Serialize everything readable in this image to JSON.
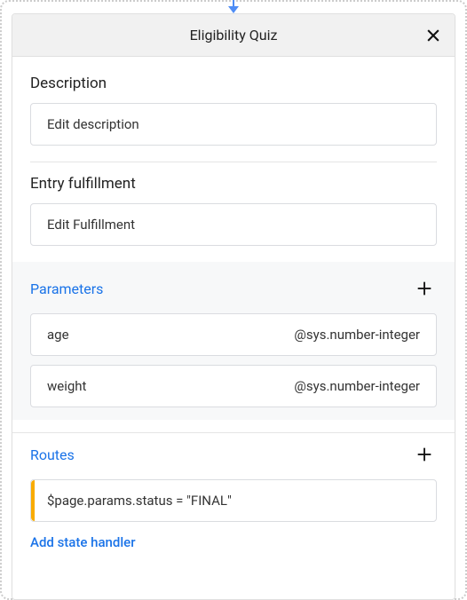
{
  "header": {
    "title": "Eligibility Quiz"
  },
  "description": {
    "label": "Description",
    "field": "Edit description"
  },
  "entryFulfillment": {
    "label": "Entry fulfillment",
    "field": "Edit Fulfillment"
  },
  "parameters": {
    "label": "Parameters",
    "items": [
      {
        "name": "age",
        "type": "@sys.number-integer"
      },
      {
        "name": "weight",
        "type": "@sys.number-integer"
      }
    ]
  },
  "routes": {
    "label": "Routes",
    "items": [
      {
        "condition": "$page.params.status = \"FINAL\""
      }
    ]
  },
  "stateHandler": {
    "link": "Add state handler"
  }
}
